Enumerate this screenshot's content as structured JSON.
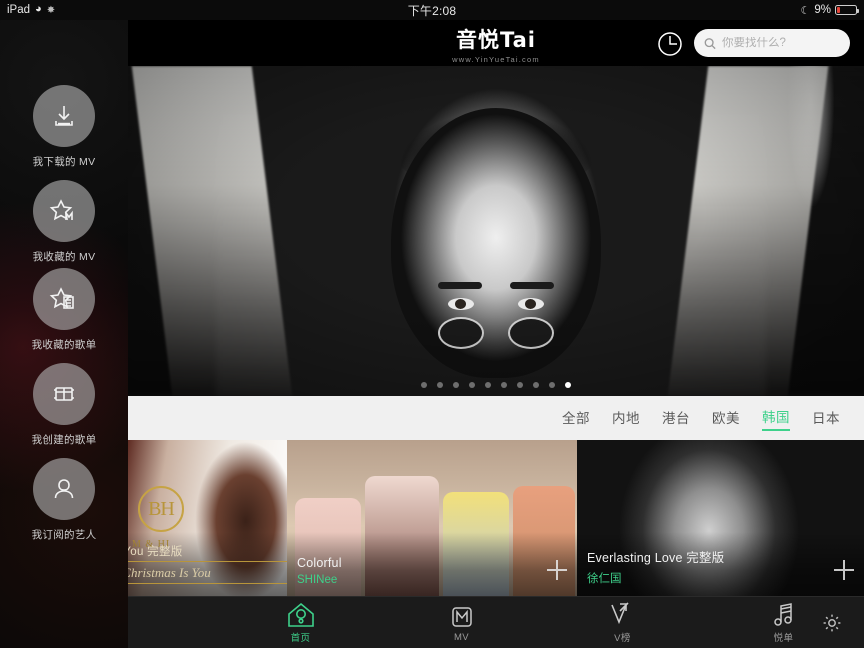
{
  "status_bar": {
    "device": "iPad",
    "wifi_icon": "wifi-icon",
    "location_icon": "location-services-icon",
    "time": "下午2:08",
    "dnd_icon": "moon-do-not-disturb-icon",
    "battery_percent": "9%"
  },
  "sidebar": {
    "items": [
      {
        "icon": "download-icon",
        "label": "我下载的 MV"
      },
      {
        "icon": "star-mv-icon",
        "label": "我收藏的 MV"
      },
      {
        "icon": "star-list-icon",
        "label": "我收藏的歌单"
      },
      {
        "icon": "create-list-icon",
        "label": "我创建的歌单"
      },
      {
        "icon": "person-icon",
        "label": "我订阅的艺人"
      }
    ]
  },
  "header": {
    "logo_main": "音悦Tai",
    "logo_sub": "www.YinYueTai.com",
    "history_icon": "clock-history-icon",
    "search": {
      "icon": "search-icon",
      "value": "",
      "placeholder": "你要找什么?"
    }
  },
  "hero": {
    "alt": "black-and-white artist portrait banner",
    "dots_total": 10,
    "dots_active_index": 9
  },
  "filter_bar": {
    "tabs": [
      {
        "label": "全部",
        "active": false
      },
      {
        "label": "内地",
        "active": false
      },
      {
        "label": "港台",
        "active": false
      },
      {
        "label": "欧美",
        "active": false
      },
      {
        "label": "韩国",
        "active": true
      },
      {
        "label": "日本",
        "active": false
      }
    ],
    "active_color": "#3ed18b"
  },
  "cards": [
    {
      "badge_main": "BH",
      "badge_sub": "M & HI",
      "title_clipped_1": "s You 完整版",
      "title_clipped_2": "r Christmas Is You",
      "add_icon": "plus-add-icon"
    },
    {
      "title": "Colorful",
      "artist": "SHINee",
      "add_icon": "plus-add-icon"
    },
    {
      "title": "Everlasting Love 完整版",
      "artist": "徐仁国",
      "add_icon": "plus-add-icon"
    }
  ],
  "bottom_nav": {
    "items": [
      {
        "icon": "home-icon",
        "label": "首页",
        "active": true
      },
      {
        "icon": "mv-icon",
        "label": "MV",
        "active": false
      },
      {
        "icon": "vchart-icon",
        "label": "V榜",
        "active": false
      },
      {
        "icon": "playlist-icon",
        "label": "悦单",
        "active": false
      }
    ],
    "settings_icon": "gear-icon",
    "active_color": "#3ed18b"
  }
}
